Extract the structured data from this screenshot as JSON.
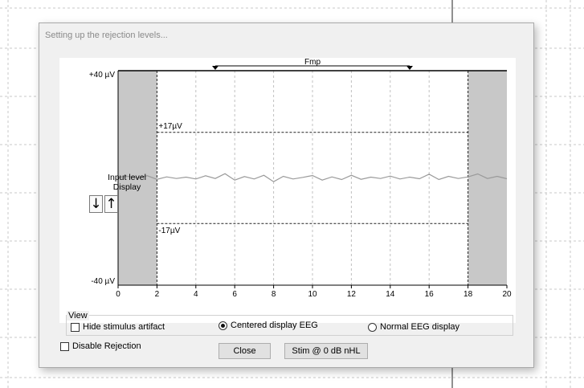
{
  "dialog": {
    "title": "Setting up the rejection levels..."
  },
  "plot": {
    "y_top_label": "+40 µV",
    "y_bottom_label": "-40 µV",
    "upper_reject_label": "+17µV",
    "lower_reject_label": "-17µV",
    "fmp_label": "Fmp",
    "x_ticks": [
      "0",
      "2",
      "4",
      "6",
      "8",
      "10",
      "12",
      "14",
      "16",
      "18",
      "20"
    ],
    "input_level_label": "Input level\nDisplay",
    "arrow_down": "↓",
    "arrow_up": "↑"
  },
  "chart_data": {
    "type": "line",
    "xlim": [
      0,
      20
    ],
    "ylim": [
      -40,
      40
    ],
    "reject_levels": [
      17,
      -17
    ],
    "fmp_range": [
      5,
      15
    ],
    "shaded_regions": [
      [
        0,
        2
      ],
      [
        18,
        20
      ]
    ],
    "series": [
      {
        "x": [
          0,
          0.5,
          1,
          1.5,
          2,
          2.5,
          3,
          3.5,
          4,
          4.5,
          5,
          5.5,
          6,
          6.5,
          7,
          7.5,
          8,
          8.5,
          9,
          9.5,
          10,
          10.5,
          11,
          11.5,
          12,
          12.5,
          13,
          13.5,
          14,
          14.5,
          15,
          15.5,
          16,
          16.5,
          17,
          17.5,
          18,
          18.5,
          19,
          19.5,
          20
        ],
        "values": [
          0.3,
          0.6,
          0,
          0.8,
          -0.5,
          0.4,
          -0.2,
          0.3,
          -0.4,
          0.8,
          -0.2,
          1.6,
          -0.8,
          0.5,
          -0.4,
          1.0,
          -1.4,
          0.6,
          -0.4,
          0.2,
          0.9,
          -0.8,
          0.4,
          -0.6,
          1.0,
          -0.5,
          0.3,
          -0.2,
          0.7,
          -0.4,
          0.3,
          -0.3,
          1.4,
          -0.6,
          0.6,
          -0.2,
          0.4,
          1.5,
          -0.2,
          0.6,
          -0.3
        ]
      }
    ]
  },
  "view": {
    "group_label": "View",
    "hide_artifact_label": "Hide stimulus artifact",
    "centered_label": "Centered display EEG",
    "normal_label": "Normal EEG display",
    "disable_rejection_label": "Disable Rejection"
  },
  "buttons": {
    "close_label": "Close",
    "stim_label": "Stim @ 0 dB nHL"
  }
}
